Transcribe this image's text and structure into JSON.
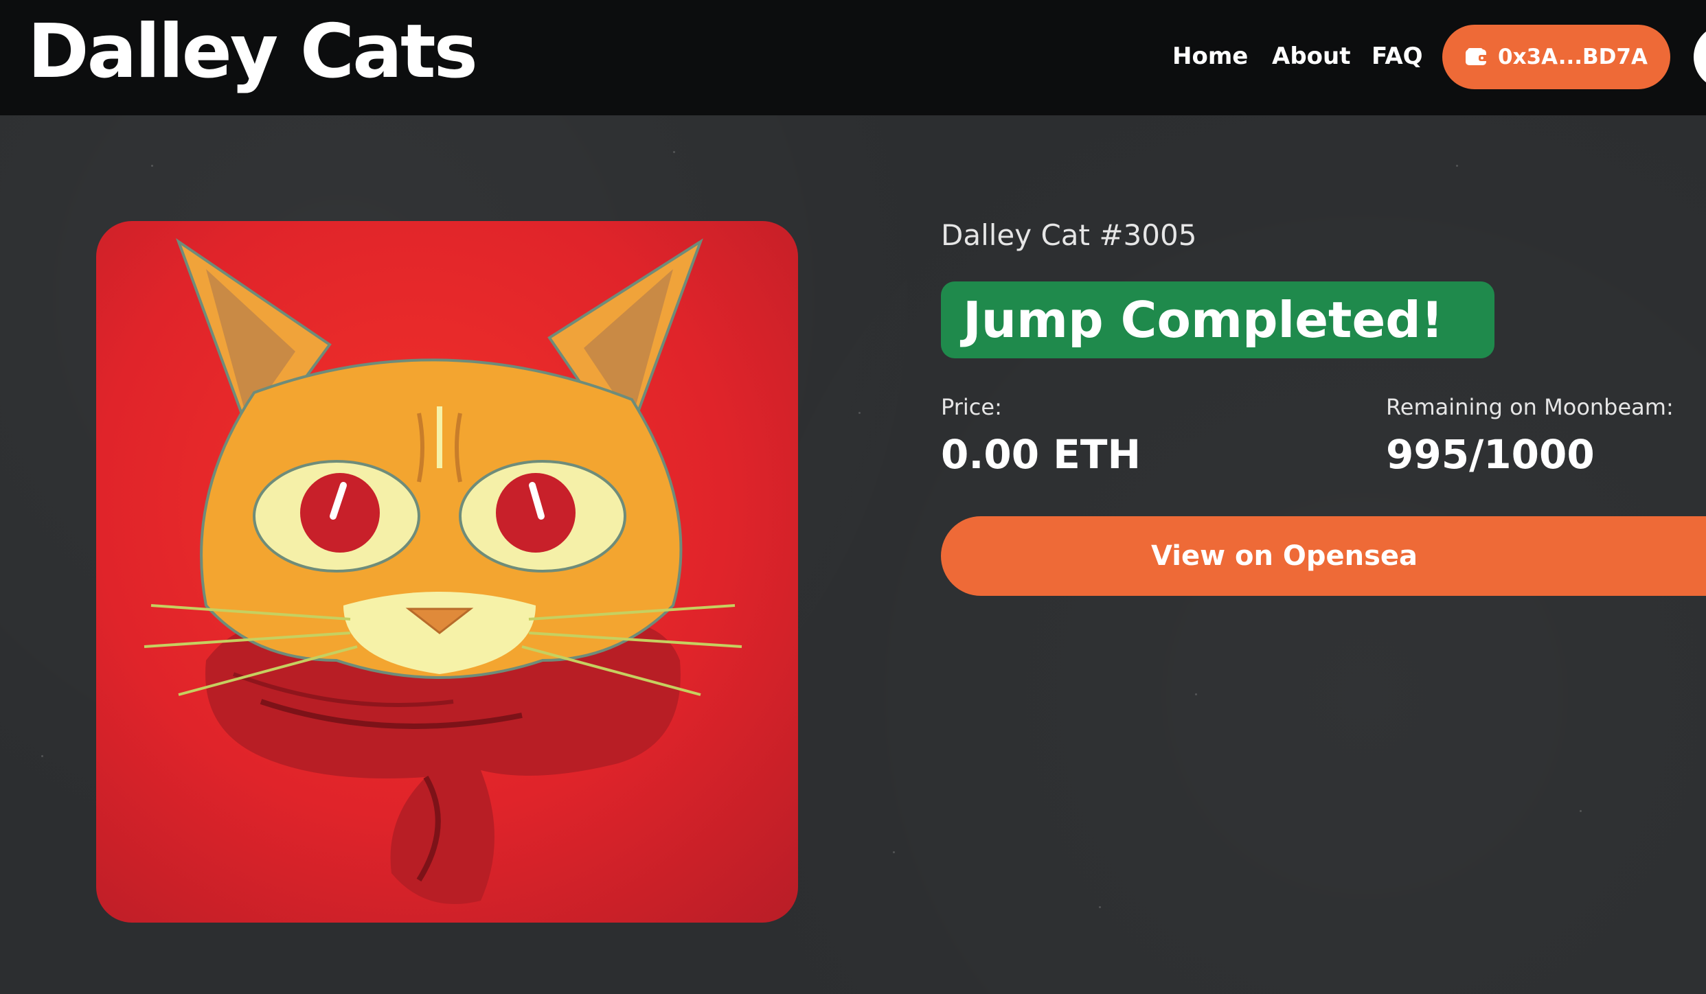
{
  "header": {
    "logo_text": "Dalley Cats",
    "nav": [
      {
        "label": "Home"
      },
      {
        "label": "About"
      },
      {
        "label": "FAQ"
      }
    ],
    "wallet": {
      "label": "0x3A...BD7A",
      "icon": "wallet-icon"
    }
  },
  "nft": {
    "name": "Dalley Cat #3005",
    "status": "Jump Completed!",
    "price_label": "Price:",
    "price_value": "0.00 ETH",
    "remaining_label": "Remaining on Moonbeam:",
    "remaining_value": "995/1000",
    "opensea_label": "View on Opensea"
  },
  "colors": {
    "accent": "#ee6a37",
    "success": "#1f8a4c",
    "header_bg": "#0c0d0e",
    "page_bg": "#2c2e30"
  }
}
